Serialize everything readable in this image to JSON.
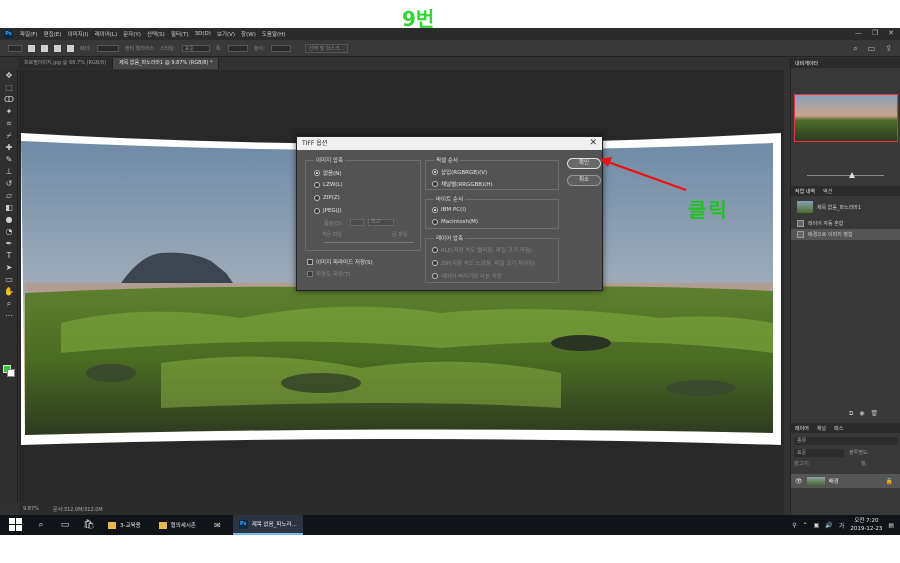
{
  "annotation": {
    "top_label": "9번",
    "click_label": "클릭"
  },
  "menubar": {
    "logo": "Ps",
    "items": [
      "파일(F)",
      "편집(E)",
      "이미지(I)",
      "레이어(L)",
      "문자(Y)",
      "선택(S)",
      "필터(T)",
      "3D(D)",
      "보기(V)",
      "창(W)",
      "도움말(H)"
    ]
  },
  "optbar": {
    "feather": "페더:",
    "antialias": "앤티 앨리어스",
    "style": "스타일:",
    "style_value": "표준",
    "width": "폭:",
    "height": "높이:",
    "select_mask": "선택 및 마스크..."
  },
  "tabs": [
    {
      "label": "프로필이미지.jpg @ 66.7% (RGB/8)"
    },
    {
      "label": "제목 없음_파노라마1 @ 9.87% (RGB/8) *"
    }
  ],
  "statusbar": {
    "zoom": "9.87%",
    "doc": "문서:312.0M/312.0M"
  },
  "panels": {
    "navigator_tab": "내비게이터",
    "history_tab": "작업 내역",
    "actions_tab": "액션",
    "history_items": [
      "제목 없음_파노라마1",
      "레이어 자동 혼합",
      "배경으로 이미지 병합"
    ],
    "layers_tab": "레이어",
    "channels_tab": "채널",
    "paths_tab": "패스",
    "layer_kind": "종류",
    "blend": "표준",
    "opacity": "불투명도:",
    "lock": "잠그기:",
    "fill": "칠:",
    "layer_name": "배경"
  },
  "dialog": {
    "title": "TIFF 옵션",
    "image_compression": "이미지 압축",
    "none": "없음(N)",
    "lzw": "LZW(L)",
    "zip": "ZIP(Z)",
    "jpeg": "JPEG(J)",
    "quality": "품질(Q):",
    "max": "최고",
    "small_file": "작은 파일",
    "large_file": "큰 파일",
    "pixel_order": "픽셀 순서",
    "interleaved": "삽입(RGBRGB)(V)",
    "per_channel": "채널별(RRGGBB)(H)",
    "byte_order": "바이트 순서",
    "ibm": "IBM PC(I)",
    "mac": "Macintosh(M)",
    "save_pyramid": "이미지 피라미드 저장(S)",
    "save_transparency": "투명도 저장(T)",
    "layer_compression": "레이어 압축",
    "rle": "RLE(저장 속도 빨라짐, 파일 크기 커짐)",
    "zip_layer": "ZIP(저장 속도 느려짐, 파일 크기 작아짐)",
    "discard": "레이어 버리기와 사본 저장",
    "ok": "확인",
    "cancel": "취소"
  },
  "taskbar": {
    "apps": [
      {
        "label": "3-교육용"
      },
      {
        "label": "협의세시촌"
      },
      {
        "label": ""
      },
      {
        "label": "제목 없음_파노라..."
      }
    ],
    "ime": "가",
    "time": "오전 7:20",
    "date": "2019-12-23"
  }
}
